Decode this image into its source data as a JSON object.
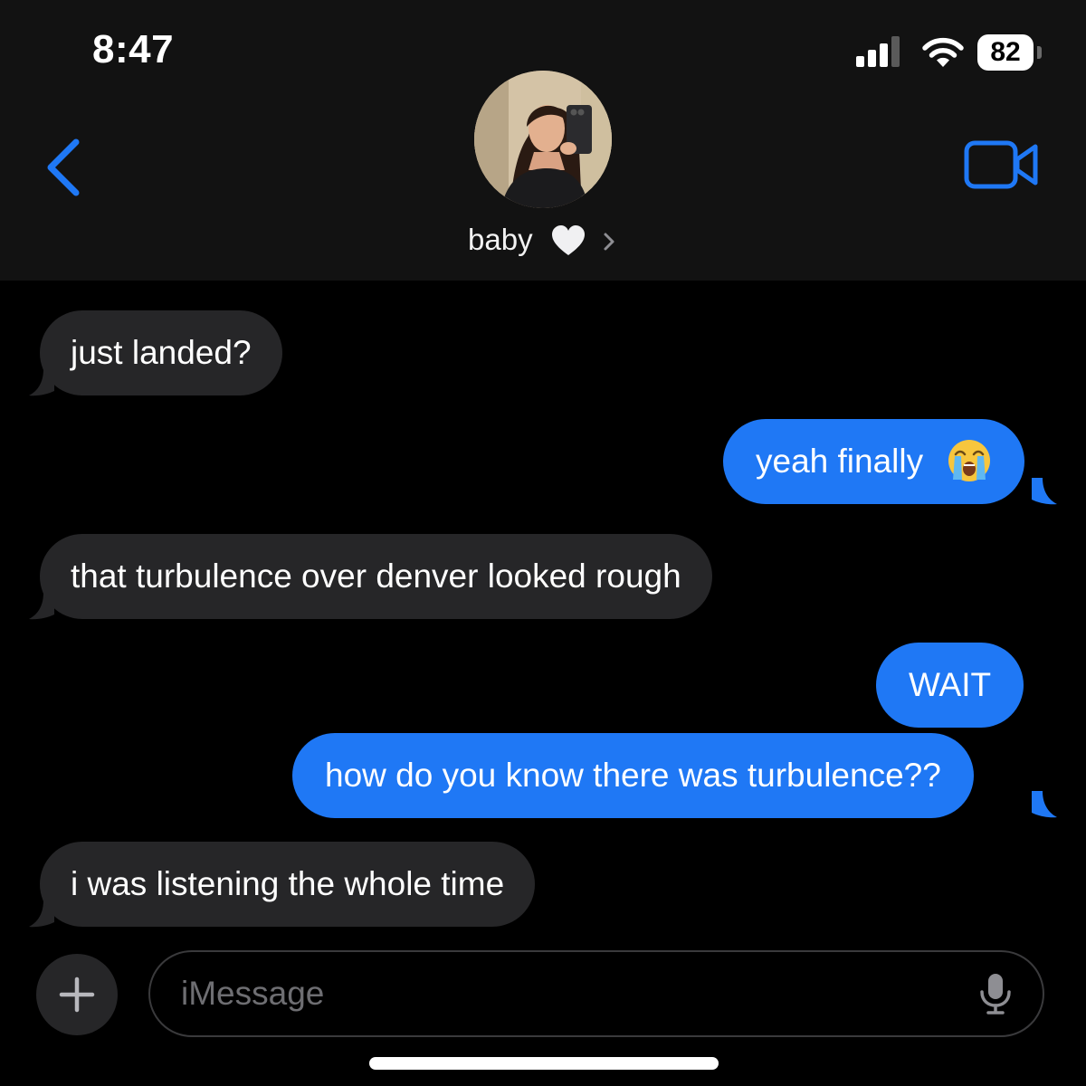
{
  "status_bar": {
    "time": "8:47",
    "battery_level": "82",
    "signal_bars_filled": 3,
    "signal_bars_total": 4
  },
  "header": {
    "contact_name": "baby",
    "name_icon": "white-heart-icon",
    "back_icon": "chevron-left-icon",
    "video_icon": "video-camera-icon"
  },
  "messages": [
    {
      "direction": "incoming",
      "text": "just landed?"
    },
    {
      "direction": "outgoing",
      "text": "yeah finally",
      "emoji": "loudly-crying-face-icon"
    },
    {
      "direction": "incoming",
      "text": "that turbulence over denver looked rough"
    },
    {
      "direction": "outgoing",
      "text": "WAIT"
    },
    {
      "direction": "outgoing",
      "text": "how do you know there was turbulence??"
    },
    {
      "direction": "incoming",
      "text": "i was listening the whole time"
    }
  ],
  "composer": {
    "placeholder": "iMessage",
    "add_icon": "plus-icon",
    "mic_icon": "microphone-icon"
  },
  "colors": {
    "accent": "#1f78f5",
    "incoming_bubble": "#262628",
    "header_bg": "#121212",
    "background": "#000000"
  }
}
